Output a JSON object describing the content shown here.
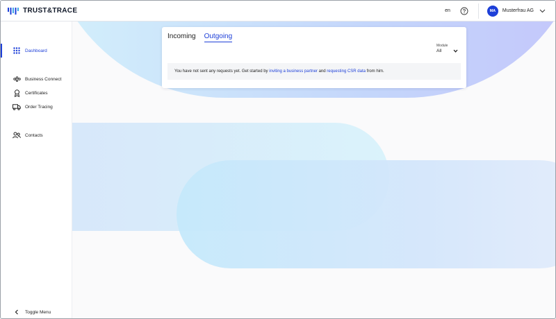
{
  "header": {
    "logo_text": "TRUST&TRACE",
    "language": "en",
    "user_initials": "MA",
    "user_name": "Musterfrau AG"
  },
  "sidebar": {
    "items": [
      {
        "label": "Dashboard",
        "icon": "grid-icon",
        "active": true
      },
      {
        "label": "Business Connect",
        "icon": "network-icon"
      },
      {
        "label": "Certificates",
        "icon": "award-icon"
      },
      {
        "label": "Order Tracing",
        "icon": "truck-icon"
      },
      {
        "label": "Contacts",
        "icon": "contacts-icon"
      }
    ],
    "toggle_label": "Toggle Menu"
  },
  "main": {
    "tabs": [
      {
        "label": "Incoming",
        "active": false
      },
      {
        "label": "Outgoing",
        "active": true
      }
    ],
    "module_filter": {
      "label": "Module",
      "value": "All"
    },
    "notice": {
      "text_before": "You have not sent any requests yet. Get started by ",
      "link1": "inviting a business partner",
      "text_middle": " and ",
      "link2": "requesting CSR data",
      "text_after": " from him."
    }
  },
  "colors": {
    "accent": "#1d3fd8"
  }
}
